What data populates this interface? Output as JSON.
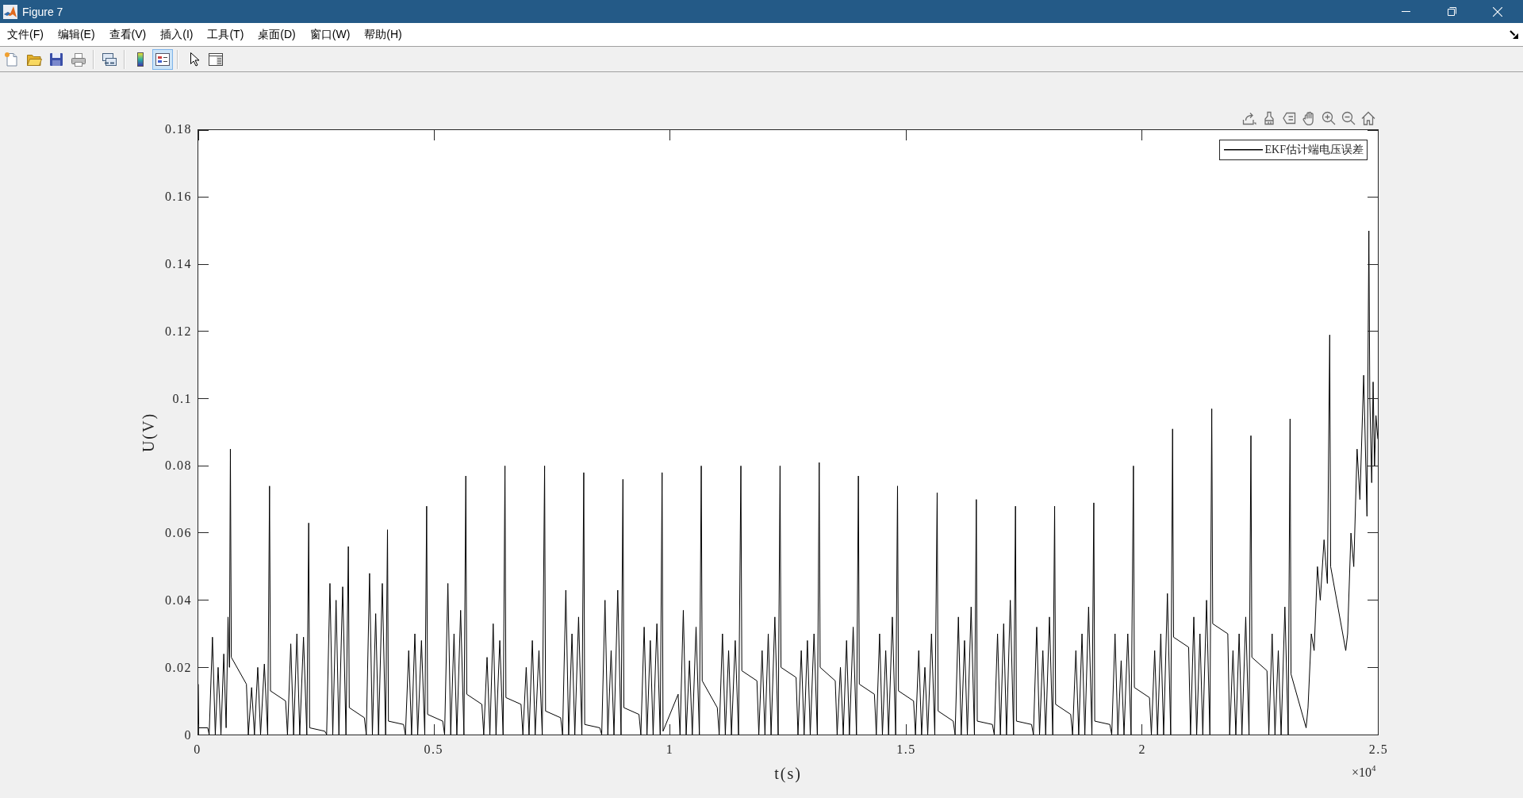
{
  "window": {
    "title": "Figure 7"
  },
  "menu": [
    {
      "label": "文件(F)"
    },
    {
      "label": "编辑(E)"
    },
    {
      "label": "查看(V)"
    },
    {
      "label": "插入(I)"
    },
    {
      "label": "工具(T)"
    },
    {
      "label": "桌面(D)"
    },
    {
      "label": "窗口(W)"
    },
    {
      "label": "帮助(H)"
    }
  ],
  "toolbar": {
    "groups": [
      {
        "buttons": [
          {
            "kind": "new",
            "on": false
          },
          {
            "kind": "open",
            "on": false
          },
          {
            "kind": "save",
            "on": false
          },
          {
            "kind": "print",
            "on": false
          }
        ]
      },
      {
        "buttons": [
          {
            "kind": "link",
            "on": false
          }
        ]
      },
      {
        "buttons": [
          {
            "kind": "colorbar",
            "on": false
          },
          {
            "kind": "legend",
            "on": true
          }
        ]
      },
      {
        "buttons": [
          {
            "kind": "pointer",
            "on": false
          },
          {
            "kind": "inspector",
            "on": false
          }
        ]
      }
    ]
  },
  "axes": {
    "x_exponent": "×10$^{4}$",
    "chart_data": {
      "type": "line",
      "xlabel": "t(s)",
      "ylabel": "U(V)",
      "xlim": [
        0,
        2.5
      ],
      "ylim": [
        0,
        0.18
      ],
      "xticks": [
        0,
        0.5,
        1,
        1.5,
        2,
        2.5
      ],
      "yticks": [
        0,
        0.02,
        0.04,
        0.06,
        0.08,
        0.1,
        0.12,
        0.14,
        0.16,
        0.18
      ],
      "x": [
        0,
        0.001,
        0.02,
        0.023,
        0.03,
        0.036,
        0.042,
        0.048,
        0.054,
        0.059,
        0.063,
        0.066,
        0.068,
        0.07,
        0.102,
        0.106,
        0.113,
        0.119,
        0.126,
        0.132,
        0.14,
        0.147,
        0.151,
        0.153,
        0.185,
        0.189,
        0.196,
        0.202,
        0.209,
        0.215,
        0.223,
        0.23,
        0.234,
        0.236,
        0.268,
        0.272,
        0.279,
        0.285,
        0.292,
        0.298,
        0.306,
        0.313,
        0.318,
        0.32,
        0.352,
        0.356,
        0.363,
        0.369,
        0.376,
        0.382,
        0.39,
        0.397,
        0.401,
        0.403,
        0.435,
        0.439,
        0.446,
        0.452,
        0.459,
        0.465,
        0.473,
        0.48,
        0.484,
        0.486,
        0.518,
        0.522,
        0.529,
        0.535,
        0.542,
        0.548,
        0.556,
        0.563,
        0.567,
        0.569,
        0.601,
        0.605,
        0.612,
        0.618,
        0.625,
        0.631,
        0.639,
        0.646,
        0.65,
        0.652,
        0.684,
        0.688,
        0.695,
        0.701,
        0.708,
        0.714,
        0.722,
        0.729,
        0.734,
        0.736,
        0.768,
        0.772,
        0.779,
        0.785,
        0.792,
        0.798,
        0.806,
        0.813,
        0.817,
        0.819,
        0.851,
        0.855,
        0.862,
        0.868,
        0.875,
        0.881,
        0.889,
        0.896,
        0.9,
        0.902,
        0.934,
        0.938,
        0.945,
        0.951,
        0.958,
        0.964,
        0.972,
        0.979,
        0.983,
        0.985,
        1.017,
        1.021,
        1.028,
        1.034,
        1.041,
        1.047,
        1.055,
        1.062,
        1.066,
        1.068,
        1.1,
        1.104,
        1.111,
        1.117,
        1.124,
        1.13,
        1.138,
        1.145,
        1.15,
        1.152,
        1.184,
        1.188,
        1.195,
        1.201,
        1.208,
        1.214,
        1.222,
        1.229,
        1.233,
        1.235,
        1.267,
        1.271,
        1.278,
        1.284,
        1.291,
        1.297,
        1.305,
        1.312,
        1.316,
        1.318,
        1.35,
        1.354,
        1.361,
        1.367,
        1.374,
        1.38,
        1.388,
        1.395,
        1.399,
        1.401,
        1.433,
        1.437,
        1.444,
        1.45,
        1.457,
        1.463,
        1.471,
        1.478,
        1.482,
        1.484,
        1.516,
        1.52,
        1.527,
        1.533,
        1.54,
        1.546,
        1.554,
        1.561,
        1.566,
        1.568,
        1.6,
        1.604,
        1.611,
        1.617,
        1.624,
        1.63,
        1.638,
        1.645,
        1.649,
        1.651,
        1.683,
        1.687,
        1.694,
        1.7,
        1.707,
        1.713,
        1.721,
        1.728,
        1.732,
        1.734,
        1.766,
        1.77,
        1.777,
        1.783,
        1.79,
        1.796,
        1.804,
        1.811,
        1.815,
        1.817,
        1.849,
        1.853,
        1.86,
        1.866,
        1.873,
        1.879,
        1.887,
        1.894,
        1.898,
        1.9,
        1.932,
        1.936,
        1.943,
        1.949,
        1.956,
        1.962,
        1.97,
        1.977,
        1.982,
        1.984,
        2.016,
        2.02,
        2.027,
        2.033,
        2.04,
        2.046,
        2.054,
        2.061,
        2.065,
        2.067,
        2.099,
        2.103,
        2.11,
        2.116,
        2.123,
        2.129,
        2.137,
        2.144,
        2.148,
        2.15,
        2.182,
        2.186,
        2.193,
        2.199,
        2.206,
        2.212,
        2.22,
        2.227,
        2.231,
        2.233,
        2.265,
        2.269,
        2.276,
        2.282,
        2.289,
        2.295,
        2.303,
        2.31,
        2.314,
        2.316,
        2.348,
        2.352,
        2.359,
        2.365,
        2.372,
        2.378,
        2.386,
        2.393,
        2.398,
        2.4,
        2.432,
        2.436,
        2.443,
        2.449,
        2.456,
        2.462,
        2.47,
        2.477,
        2.481,
        2.483,
        2.487,
        2.49,
        2.493,
        2.496,
        2.5
      ],
      "series": [
        {
          "name": "EKF估计端电压误差",
          "color": "#000000",
          "values": [
            0.015,
            0.002,
            0.002,
            0,
            0.029,
            0,
            0.02,
            0,
            0.024,
            0.002,
            0.035,
            0.02,
            0.085,
            0.023,
            0.015,
            0,
            0.014,
            0,
            0.02,
            0,
            0.021,
            0,
            0.074,
            0.013,
            0.01,
            0,
            0.027,
            0,
            0.03,
            0,
            0.029,
            0,
            0.063,
            0.002,
            0.001,
            0,
            0.045,
            0,
            0.04,
            0,
            0.044,
            0,
            0.056,
            0.008,
            0.005,
            0,
            0.048,
            0,
            0.036,
            0,
            0.045,
            0,
            0.061,
            0.004,
            0.003,
            0,
            0.025,
            0,
            0.03,
            0,
            0.028,
            0,
            0.068,
            0.006,
            0.004,
            0,
            0.045,
            0,
            0.03,
            0,
            0.037,
            0,
            0.077,
            0.012,
            0.009,
            0,
            0.023,
            0,
            0.033,
            0,
            0.028,
            0,
            0.08,
            0.011,
            0.009,
            0,
            0.02,
            0,
            0.028,
            0,
            0.025,
            0,
            0.08,
            0.007,
            0.005,
            0,
            0.043,
            0,
            0.03,
            0,
            0.035,
            0,
            0.078,
            0.003,
            0.002,
            0,
            0.04,
            0,
            0.025,
            0,
            0.043,
            0,
            0.076,
            0.008,
            0.006,
            0,
            0.032,
            0,
            0.028,
            0,
            0.033,
            0,
            0.078,
            0.001,
            0.012,
            0,
            0.037,
            0,
            0.022,
            0,
            0.032,
            0,
            0.08,
            0.016,
            0.008,
            0,
            0.03,
            0,
            0.025,
            0,
            0.028,
            0,
            0.08,
            0.019,
            0.016,
            0,
            0.025,
            0,
            0.03,
            0,
            0.035,
            0,
            0.08,
            0.02,
            0.017,
            0,
            0.025,
            0,
            0.028,
            0,
            0.03,
            0,
            0.081,
            0.02,
            0.016,
            0,
            0.02,
            0,
            0.028,
            0,
            0.032,
            0,
            0.077,
            0.015,
            0.012,
            0,
            0.03,
            0,
            0.025,
            0,
            0.035,
            0,
            0.074,
            0.013,
            0.01,
            0,
            0.025,
            0,
            0.02,
            0,
            0.03,
            0,
            0.072,
            0.007,
            0.004,
            0,
            0.035,
            0,
            0.028,
            0,
            0.038,
            0,
            0.07,
            0.004,
            0.003,
            0,
            0.03,
            0,
            0.033,
            0,
            0.04,
            0,
            0.068,
            0.004,
            0.003,
            0,
            0.032,
            0,
            0.025,
            0,
            0.035,
            0,
            0.068,
            0.009,
            0.006,
            0,
            0.025,
            0,
            0.03,
            0,
            0.038,
            0,
            0.069,
            0.004,
            0.003,
            0,
            0.03,
            0,
            0.022,
            0,
            0.03,
            0,
            0.08,
            0.014,
            0.011,
            0,
            0.025,
            0,
            0.03,
            0,
            0.042,
            0,
            0.091,
            0.029,
            0.026,
            0,
            0.035,
            0,
            0.03,
            0,
            0.04,
            0,
            0.097,
            0.033,
            0.03,
            0,
            0.025,
            0,
            0.03,
            0,
            0.035,
            0,
            0.089,
            0.023,
            0.019,
            0,
            0.03,
            0,
            0.025,
            0,
            0.038,
            0,
            0.094,
            0.018,
            0.002,
            0.008,
            0.03,
            0.025,
            0.05,
            0.04,
            0.058,
            0.045,
            0.119,
            0.05,
            0.025,
            0.03,
            0.06,
            0.05,
            0.085,
            0.07,
            0.107,
            0.065,
            0.15,
            0.1,
            0.075,
            0.105,
            0.08,
            0.095,
            0.088
          ]
        }
      ]
    }
  }
}
